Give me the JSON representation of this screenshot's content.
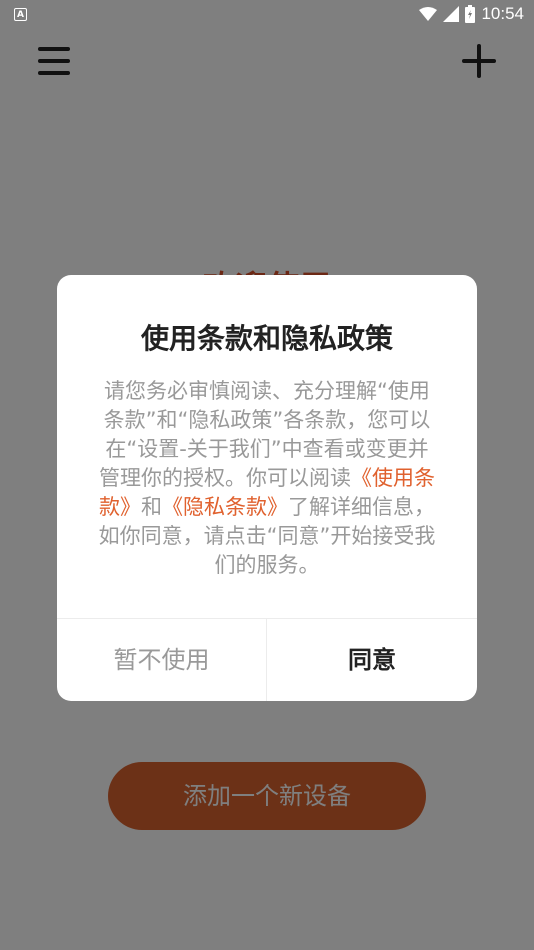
{
  "status_bar": {
    "notification_icon_letter": "A",
    "time": "10:54"
  },
  "main": {
    "title": "欢迎使用",
    "add_device_label": "添加一个新设备"
  },
  "dialog": {
    "title": "使用条款和隐私政策",
    "body_text_1": "请您务必审慎阅读、充分理解“使用条款”和“隐私政策”各条款，您可以在“设置-关于我们”中查看或变更并管理你的授权。你可以阅读",
    "terms_link": "《使用条款》",
    "body_text_2": "和",
    "privacy_link": "《隐私条款》",
    "body_text_3": "了解详细信息，如你同意，请点击“同意”开始接受我们的服务。",
    "decline_label": "暂不使用",
    "agree_label": "同意"
  },
  "colors": {
    "accent": "#d9622f",
    "link": "#e0612e"
  }
}
